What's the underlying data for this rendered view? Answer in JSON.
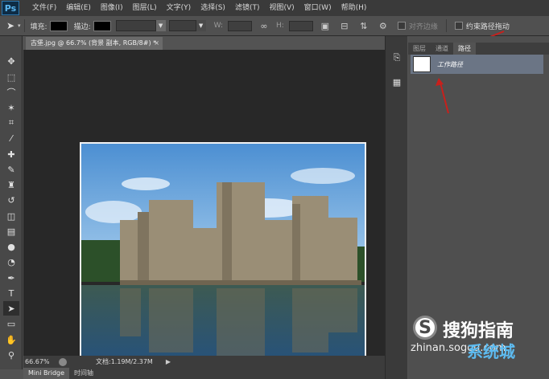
{
  "app": {
    "logo": "Ps"
  },
  "menu": [
    "文件(F)",
    "编辑(E)",
    "图像(I)",
    "图层(L)",
    "文字(Y)",
    "选择(S)",
    "滤镜(T)",
    "视图(V)",
    "窗口(W)",
    "帮助(H)"
  ],
  "options": {
    "fill_label": "填充:",
    "stroke_label": "描边:",
    "width_label": "W:",
    "height_label": "H:",
    "align_edges": "对齐边缘",
    "constrain_path": "约束路径拖动"
  },
  "document": {
    "tab_title": "古堡.jpg @ 66.7% (背景 副本, RGB/8#) *",
    "close": "×"
  },
  "status": {
    "zoom": "66.67%",
    "doc_info": "文档:1.19M/2.37M"
  },
  "bottom_tabs": [
    "Mini Bridge",
    "时间轴"
  ],
  "panel": {
    "tabs": [
      "图层",
      "通道",
      "路径"
    ],
    "active_tab": "路径",
    "path_item": "工作路径"
  },
  "watermark": {
    "brand": "搜狗指南",
    "url": "zhinan.sogou.com",
    "site": "系统城"
  },
  "colors": {
    "accent_red": "#c8201c",
    "selection": "#6b7585"
  }
}
